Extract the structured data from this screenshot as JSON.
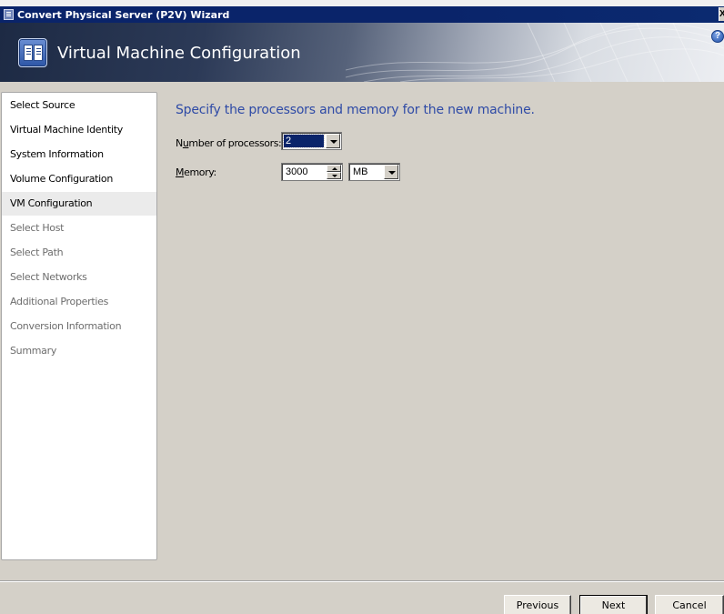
{
  "window": {
    "title": "Convert Physical Server (P2V) Wizard",
    "close_glyph": "X"
  },
  "header": {
    "title": "Virtual Machine Configuration",
    "icon": "wizard-icon",
    "help_glyph": "?"
  },
  "steps": [
    {
      "label": "Select Source",
      "state": "done"
    },
    {
      "label": "Virtual Machine Identity",
      "state": "done"
    },
    {
      "label": "System Information",
      "state": "done"
    },
    {
      "label": "Volume Configuration",
      "state": "done"
    },
    {
      "label": "VM Configuration",
      "state": "current"
    },
    {
      "label": "Select Host",
      "state": "future"
    },
    {
      "label": "Select Path",
      "state": "future"
    },
    {
      "label": "Select Networks",
      "state": "future"
    },
    {
      "label": "Additional Properties",
      "state": "future"
    },
    {
      "label": "Conversion Information",
      "state": "future"
    },
    {
      "label": "Summary",
      "state": "future"
    }
  ],
  "main": {
    "heading": "Specify the processors and memory for the new machine.",
    "processors": {
      "label_before": "N",
      "label_accel": "u",
      "label_after": "mber of processors:",
      "value": "2"
    },
    "memory": {
      "label_accel": "M",
      "label_after": "emory:",
      "value": "3000",
      "unit": "MB"
    }
  },
  "footer": {
    "previous_label": "Previous",
    "next_label": "Next",
    "cancel_label": "Cancel"
  },
  "colors": {
    "accent": "#2e4aa6",
    "titlebar": "#0a246a"
  }
}
